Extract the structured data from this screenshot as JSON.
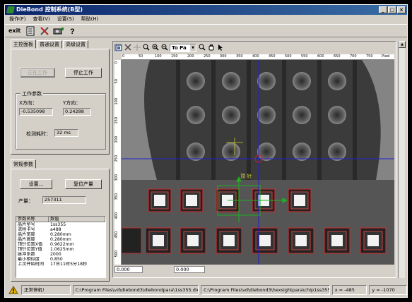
{
  "window": {
    "title": "DieBond 控制系统(B型)",
    "controls": [
      "_",
      "□",
      "×"
    ]
  },
  "menu": [
    "操作(F)",
    "查看(V)",
    "设置(S)",
    "帮助(H)"
  ],
  "toolbar": {
    "exit_label": "exit"
  },
  "left_panel": {
    "tabs": [
      "主控面板",
      "普通设置",
      "高级设置"
    ],
    "start_button": "正在工作",
    "stop_button": "停止工作",
    "params_group": "工作参数",
    "x_label": "X方向：",
    "y_label": "Y方向：",
    "x_value": "-0.535098",
    "y_value": "0.24288",
    "time_label": "检测耗时：",
    "time_value": "32 ms",
    "tab2": "常规参数",
    "settings_button": "设置...",
    "reset_button": "复位产量",
    "output_label": "产量：",
    "output_value": "257311",
    "list_headers": [
      "参数名称",
      "数值"
    ],
    "list_rows": [
      [
        "晶片型号",
        "1ss355"
      ],
      [
        "流程卡号",
        "a488"
      ],
      [
        "晶片宽度",
        "0.280mm"
      ],
      [
        "晶片高度",
        "0.280mm"
      ],
      [
        "顶针位置X值",
        "0.9622mm"
      ],
      [
        "顶针位置Y值",
        "1.0625mm"
      ],
      [
        "脉冲系数",
        "2000"
      ],
      [
        "最小相似度",
        "0.850"
      ],
      [
        "上次开始时间",
        "17日11时5分18秒"
      ]
    ]
  },
  "image_pane": {
    "zoom_select": "To Pa",
    "top_ruler": [
      "0",
      "50",
      "100",
      "150",
      "200",
      "250",
      "300",
      "350",
      "400",
      "450",
      "500",
      "550",
      "600",
      "650",
      "700",
      "750",
      "Pixel"
    ],
    "left_ruler": [
      "0",
      "50",
      "100",
      "150",
      "200",
      "250",
      "300",
      "350",
      "400",
      "450",
      "500"
    ],
    "overlay_label": "顶 针",
    "coord_x": "0.000",
    "coord_y": "0.000"
  },
  "status_bar": {
    "state": "正常停机!",
    "path1": "C:\\Program Files\\vd\\diebond3\\diebondpara\\1ss355.die",
    "path2": "C:\\Program Files\\vd\\diebond3\\hexsightpara\\chip1ss355.cfg",
    "x": "x = -485",
    "y": "y = -1070"
  }
}
